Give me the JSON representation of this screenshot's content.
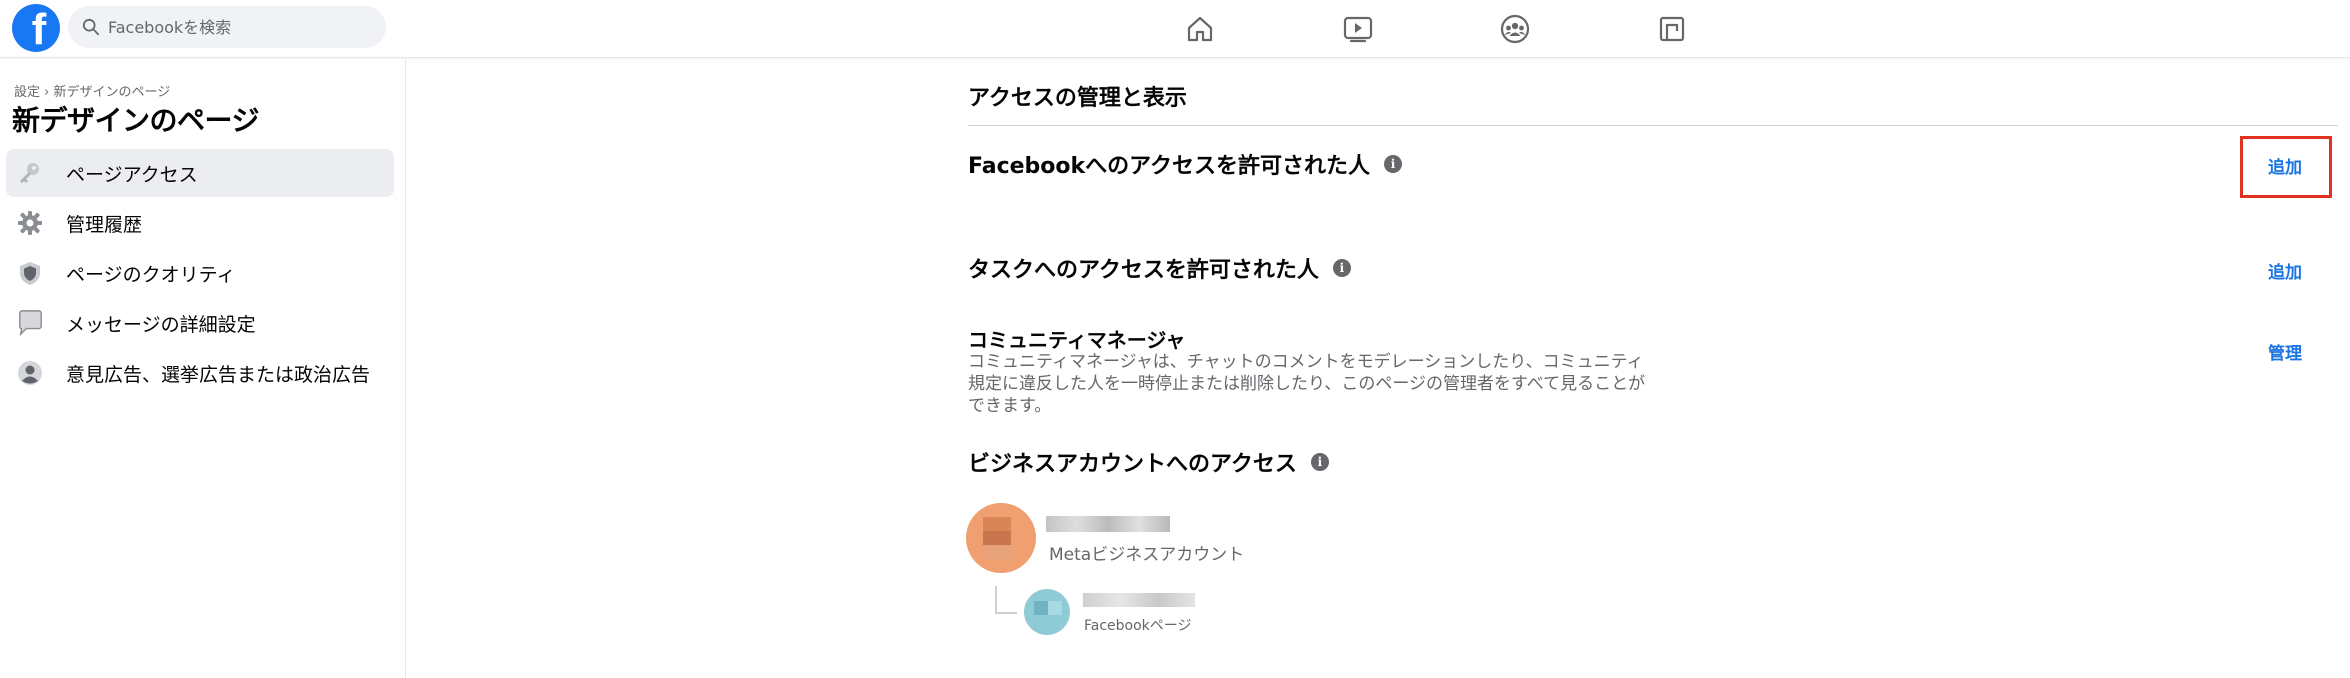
{
  "topbar": {
    "logo_letter": "f",
    "search_placeholder": "Facebookを検索",
    "nav_icons": [
      "home-icon",
      "watch-icon",
      "groups-icon",
      "gaming-icon"
    ]
  },
  "sidebar": {
    "breadcrumb": "設定 › 新デザインのページ",
    "title": "新デザインのページ",
    "items": [
      {
        "label": "ページアクセス",
        "icon": "key-icon",
        "active": true
      },
      {
        "label": "管理履歴",
        "icon": "gear-icon",
        "active": false
      },
      {
        "label": "ページのクオリティ",
        "icon": "shield-icon",
        "active": false
      },
      {
        "label": "メッセージの詳細設定",
        "icon": "speech-bubble-icon",
        "active": false
      },
      {
        "label": "意見広告、選挙広告または政治広告",
        "icon": "person-icon",
        "active": false
      }
    ]
  },
  "main": {
    "heading": "アクセスの管理と表示",
    "facebook_access": {
      "title": "Facebookへのアクセスを許可された人",
      "action": "追加"
    },
    "task_access": {
      "title": "タスクへのアクセスを許可された人",
      "action": "追加"
    },
    "community_manager": {
      "title": "コミュニティマネージャ",
      "description_lines": [
        "コミュニティマネージャは、チャットのコメントをモデレーションしたり、コミュニティ",
        "規定に違反した人を一時停止または削除したり、このページの管理者をすべて見ることが",
        "できます。"
      ],
      "action": "管理"
    },
    "business_access": {
      "title": "ビジネスアカウントへのアクセス",
      "business_account_type": "Metaビジネスアカウント",
      "page_type": "Facebookページ"
    }
  },
  "colors": {
    "brand": "#1877f2",
    "link": "#1b74e4",
    "highlight": "#e0321e",
    "business_avatar": "#f0a070",
    "page_avatar": "#8ecbd6"
  }
}
